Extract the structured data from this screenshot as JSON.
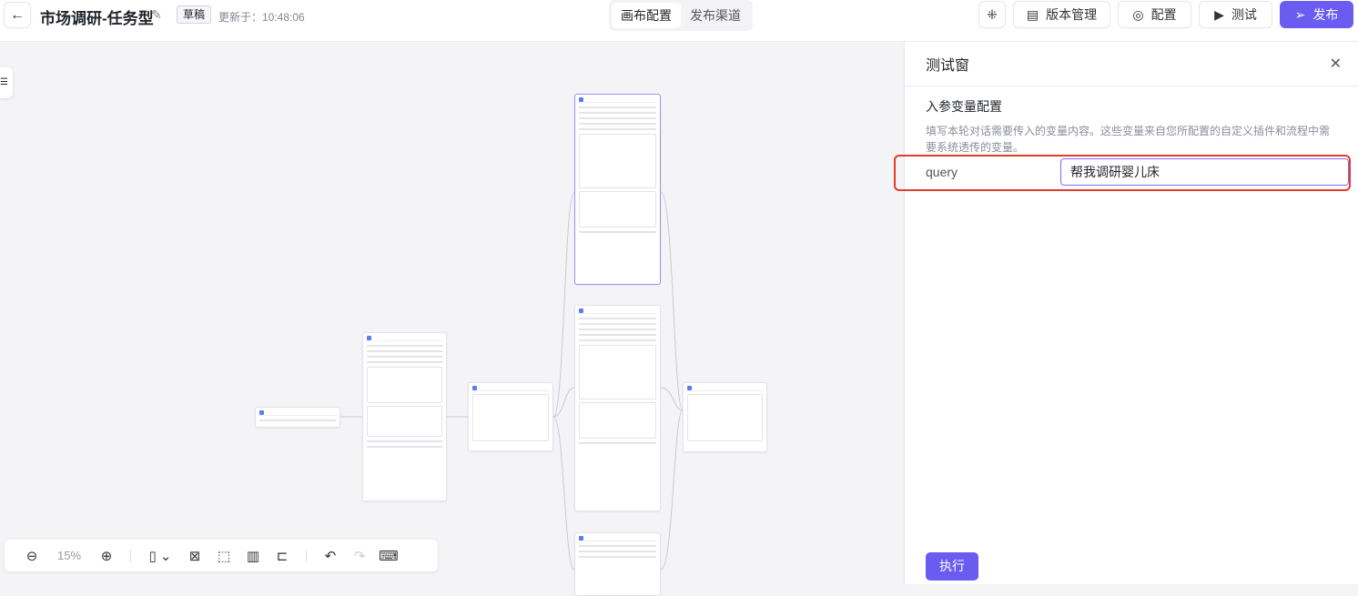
{
  "header": {
    "back_icon": "arrow-left-icon",
    "title": "市场调研-任务型",
    "edit_icon": "pencil-icon",
    "status_badge": "草稿",
    "updated": "更新于：10:48:06",
    "tabs": [
      {
        "label": "画布配置",
        "active": true
      },
      {
        "label": "发布渠道",
        "active": false
      }
    ],
    "buttons": {
      "collapse_icon": "compress-icon",
      "version": "版本管理",
      "config": "配置",
      "test": "测试",
      "publish": "发布"
    }
  },
  "toolbar": {
    "zoom": "15%"
  },
  "test_panel": {
    "title": "测试窗",
    "section_title": "入参变量配置",
    "description": "填写本轮对话需要传入的变量内容。这些变量来自您所配置的自定义插件和流程中需要系统透传的变量。",
    "variables": [
      {
        "name": "query",
        "value": "帮我调研婴儿床"
      }
    ],
    "run_button": "执行"
  },
  "colors": {
    "accent": "#6a5cf0",
    "highlight": "#e43b2a"
  }
}
